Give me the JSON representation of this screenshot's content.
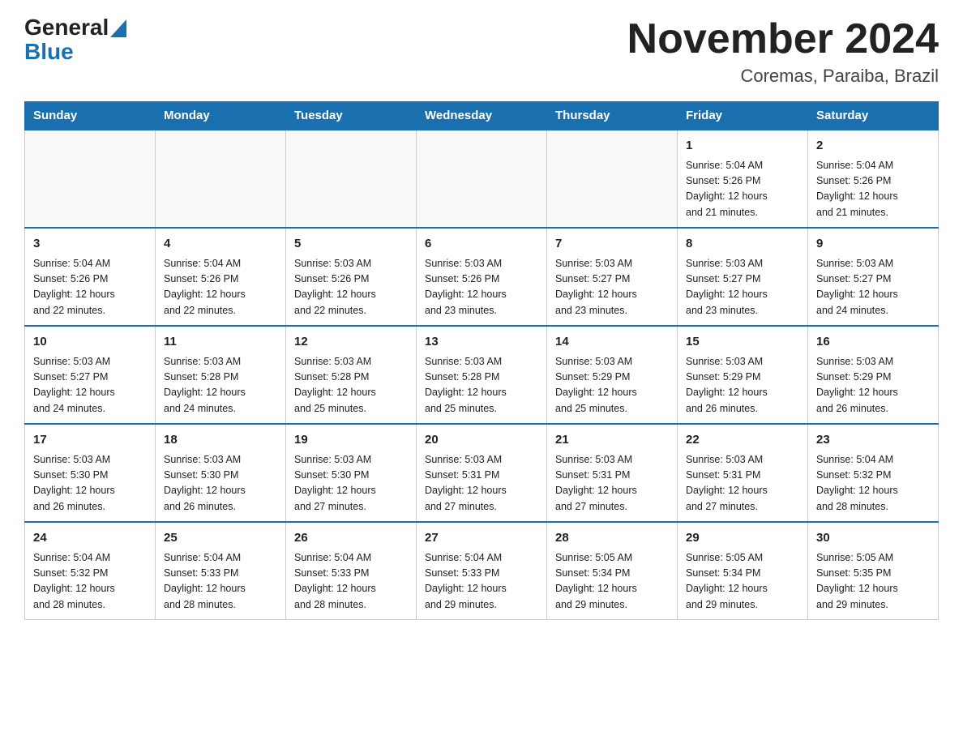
{
  "logo": {
    "general": "General",
    "blue": "Blue"
  },
  "header": {
    "title": "November 2024",
    "subtitle": "Coremas, Paraiba, Brazil"
  },
  "weekdays": [
    "Sunday",
    "Monday",
    "Tuesday",
    "Wednesday",
    "Thursday",
    "Friday",
    "Saturday"
  ],
  "weeks": [
    [
      {
        "day": "",
        "info": ""
      },
      {
        "day": "",
        "info": ""
      },
      {
        "day": "",
        "info": ""
      },
      {
        "day": "",
        "info": ""
      },
      {
        "day": "",
        "info": ""
      },
      {
        "day": "1",
        "info": "Sunrise: 5:04 AM\nSunset: 5:26 PM\nDaylight: 12 hours\nand 21 minutes."
      },
      {
        "day": "2",
        "info": "Sunrise: 5:04 AM\nSunset: 5:26 PM\nDaylight: 12 hours\nand 21 minutes."
      }
    ],
    [
      {
        "day": "3",
        "info": "Sunrise: 5:04 AM\nSunset: 5:26 PM\nDaylight: 12 hours\nand 22 minutes."
      },
      {
        "day": "4",
        "info": "Sunrise: 5:04 AM\nSunset: 5:26 PM\nDaylight: 12 hours\nand 22 minutes."
      },
      {
        "day": "5",
        "info": "Sunrise: 5:03 AM\nSunset: 5:26 PM\nDaylight: 12 hours\nand 22 minutes."
      },
      {
        "day": "6",
        "info": "Sunrise: 5:03 AM\nSunset: 5:26 PM\nDaylight: 12 hours\nand 23 minutes."
      },
      {
        "day": "7",
        "info": "Sunrise: 5:03 AM\nSunset: 5:27 PM\nDaylight: 12 hours\nand 23 minutes."
      },
      {
        "day": "8",
        "info": "Sunrise: 5:03 AM\nSunset: 5:27 PM\nDaylight: 12 hours\nand 23 minutes."
      },
      {
        "day": "9",
        "info": "Sunrise: 5:03 AM\nSunset: 5:27 PM\nDaylight: 12 hours\nand 24 minutes."
      }
    ],
    [
      {
        "day": "10",
        "info": "Sunrise: 5:03 AM\nSunset: 5:27 PM\nDaylight: 12 hours\nand 24 minutes."
      },
      {
        "day": "11",
        "info": "Sunrise: 5:03 AM\nSunset: 5:28 PM\nDaylight: 12 hours\nand 24 minutes."
      },
      {
        "day": "12",
        "info": "Sunrise: 5:03 AM\nSunset: 5:28 PM\nDaylight: 12 hours\nand 25 minutes."
      },
      {
        "day": "13",
        "info": "Sunrise: 5:03 AM\nSunset: 5:28 PM\nDaylight: 12 hours\nand 25 minutes."
      },
      {
        "day": "14",
        "info": "Sunrise: 5:03 AM\nSunset: 5:29 PM\nDaylight: 12 hours\nand 25 minutes."
      },
      {
        "day": "15",
        "info": "Sunrise: 5:03 AM\nSunset: 5:29 PM\nDaylight: 12 hours\nand 26 minutes."
      },
      {
        "day": "16",
        "info": "Sunrise: 5:03 AM\nSunset: 5:29 PM\nDaylight: 12 hours\nand 26 minutes."
      }
    ],
    [
      {
        "day": "17",
        "info": "Sunrise: 5:03 AM\nSunset: 5:30 PM\nDaylight: 12 hours\nand 26 minutes."
      },
      {
        "day": "18",
        "info": "Sunrise: 5:03 AM\nSunset: 5:30 PM\nDaylight: 12 hours\nand 26 minutes."
      },
      {
        "day": "19",
        "info": "Sunrise: 5:03 AM\nSunset: 5:30 PM\nDaylight: 12 hours\nand 27 minutes."
      },
      {
        "day": "20",
        "info": "Sunrise: 5:03 AM\nSunset: 5:31 PM\nDaylight: 12 hours\nand 27 minutes."
      },
      {
        "day": "21",
        "info": "Sunrise: 5:03 AM\nSunset: 5:31 PM\nDaylight: 12 hours\nand 27 minutes."
      },
      {
        "day": "22",
        "info": "Sunrise: 5:03 AM\nSunset: 5:31 PM\nDaylight: 12 hours\nand 27 minutes."
      },
      {
        "day": "23",
        "info": "Sunrise: 5:04 AM\nSunset: 5:32 PM\nDaylight: 12 hours\nand 28 minutes."
      }
    ],
    [
      {
        "day": "24",
        "info": "Sunrise: 5:04 AM\nSunset: 5:32 PM\nDaylight: 12 hours\nand 28 minutes."
      },
      {
        "day": "25",
        "info": "Sunrise: 5:04 AM\nSunset: 5:33 PM\nDaylight: 12 hours\nand 28 minutes."
      },
      {
        "day": "26",
        "info": "Sunrise: 5:04 AM\nSunset: 5:33 PM\nDaylight: 12 hours\nand 28 minutes."
      },
      {
        "day": "27",
        "info": "Sunrise: 5:04 AM\nSunset: 5:33 PM\nDaylight: 12 hours\nand 29 minutes."
      },
      {
        "day": "28",
        "info": "Sunrise: 5:05 AM\nSunset: 5:34 PM\nDaylight: 12 hours\nand 29 minutes."
      },
      {
        "day": "29",
        "info": "Sunrise: 5:05 AM\nSunset: 5:34 PM\nDaylight: 12 hours\nand 29 minutes."
      },
      {
        "day": "30",
        "info": "Sunrise: 5:05 AM\nSunset: 5:35 PM\nDaylight: 12 hours\nand 29 minutes."
      }
    ]
  ]
}
